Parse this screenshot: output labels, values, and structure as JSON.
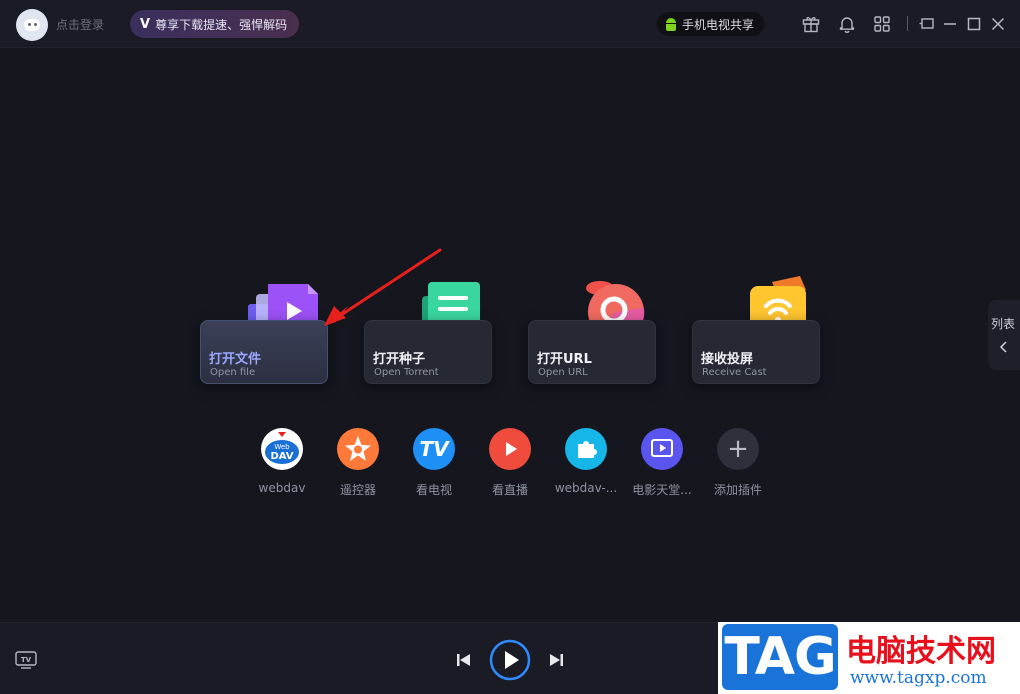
{
  "header": {
    "login_text": "点击登录",
    "vip_icon": "V",
    "vip_promo": "尊享下载提速、强悍解码",
    "share_button": "手机电视共享"
  },
  "sidebar_tab": {
    "label": "列表"
  },
  "cards": [
    {
      "title": "打开文件",
      "subtitle": "Open file"
    },
    {
      "title": "打开种子",
      "subtitle": "Open Torrent"
    },
    {
      "title": "打开URL",
      "subtitle": "Open URL"
    },
    {
      "title": "接收投屏",
      "subtitle": "Receive Cast"
    }
  ],
  "plugins": [
    {
      "label": "webdav",
      "badge_top": "Web",
      "badge_bottom": "DAV"
    },
    {
      "label": "遥控器"
    },
    {
      "label": "看电视",
      "badge": "TV"
    },
    {
      "label": "看直播"
    },
    {
      "label": "webdav-..."
    },
    {
      "label": "电影天堂..."
    },
    {
      "label": "添加插件",
      "badge": "+"
    }
  ],
  "footer": {
    "tv_icon_text": "TV"
  },
  "watermark": {
    "tag": "TAG",
    "site_name": "电脑技术网",
    "url": "www.tagxp.com"
  },
  "colors": {
    "accent": "#2f8bff",
    "background": "#16161f",
    "active_title": "#9aa9ff",
    "watermark_red": "#e8101c",
    "watermark_blue": "#1a73d9"
  }
}
